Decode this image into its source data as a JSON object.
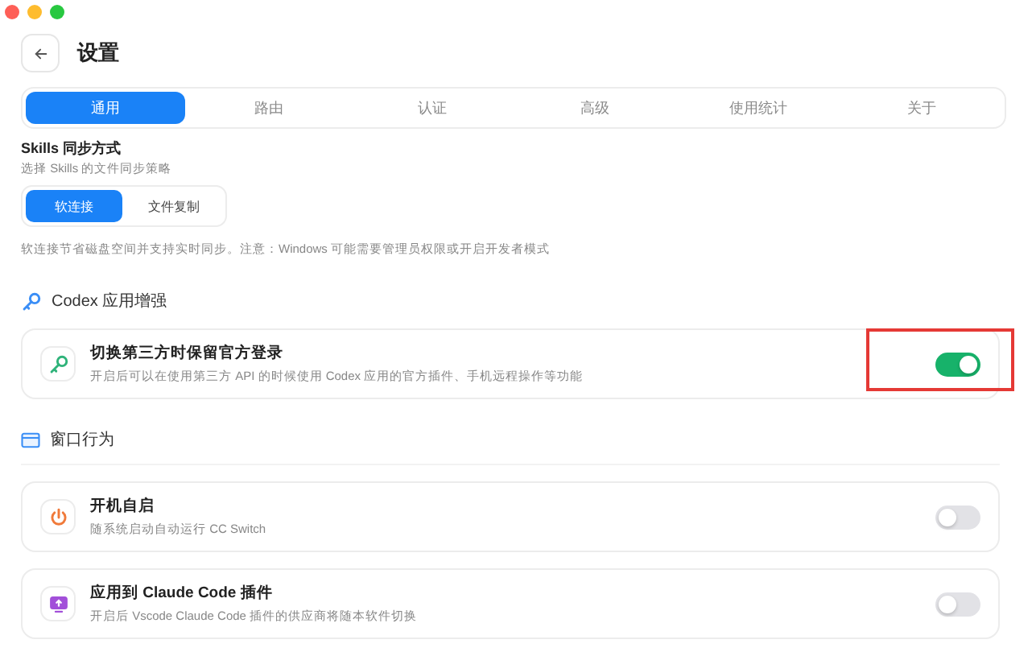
{
  "window": {
    "title": "设置"
  },
  "tabs": [
    {
      "label": "通用",
      "selected": true
    },
    {
      "label": "路由",
      "selected": false
    },
    {
      "label": "认证",
      "selected": false
    },
    {
      "label": "高级",
      "selected": false
    },
    {
      "label": "使用统计",
      "selected": false
    },
    {
      "label": "关于",
      "selected": false
    }
  ],
  "skills_sync": {
    "title": "Skills 同步方式",
    "description": "选择 Skills 的文件同步策略",
    "options": [
      {
        "label": "软连接",
        "selected": true
      },
      {
        "label": "文件复制",
        "selected": false
      }
    ],
    "note": "软连接节省磁盘空间并支持实时同步。注意：Windows 可能需要管理员权限或开启开发者模式"
  },
  "sections": [
    {
      "title": "Codex 应用增强",
      "kind": "key",
      "settings": [
        {
          "title": "切换第三方时保留官方登录",
          "description": "开启后可以在使用第三方 API 的时候使用 Codex 应用的官方插件、手机远程操作等功能",
          "kind": "key",
          "color": "#2fb37a",
          "on": true,
          "highlighted": true
        }
      ]
    },
    {
      "title": "窗口行为",
      "kind": "window",
      "settings": [
        {
          "title": "开机自启",
          "description": "随系统启动自动运行 CC Switch",
          "kind": "power",
          "color": "#f07a3a",
          "on": false,
          "highlighted": false
        },
        {
          "title": "应用到 Claude Code 插件",
          "description": "开启后 Vscode Claude Code 插件的供应商将随本软件切换",
          "kind": "monitor",
          "color": "#a24fd9",
          "on": false,
          "highlighted": false
        }
      ]
    }
  ]
}
